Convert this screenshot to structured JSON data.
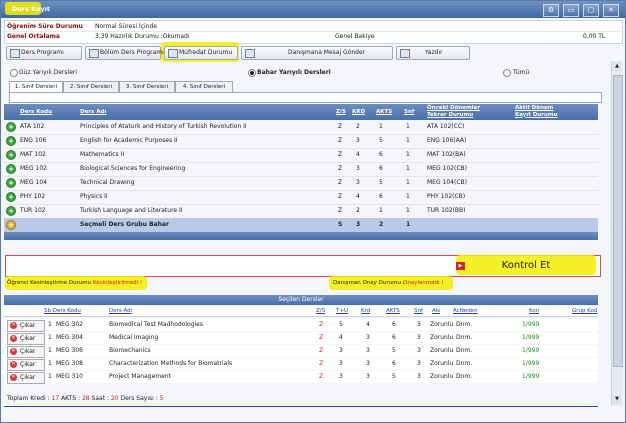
{
  "window": {
    "title": "Ders Kayıt",
    "buttons": [
      "⚙",
      "▭",
      "▢",
      "✕"
    ]
  },
  "info": {
    "status_label": "Öğrenim Süre Durumu",
    "status_value": "Normal Süresi İçinde",
    "gpa_label": "Genel Ortalama",
    "gpa_value": "3,39 Hazırlık Durumu :Okumadı",
    "balance_label": "Genel Bakiye",
    "balance_value": "0,00 TL"
  },
  "toolbar": {
    "ders_programi": "Ders Programı",
    "bolum_ders_programi": "Bölüm Ders Programı",
    "mufredat_durumu": "Müfredat Durumu",
    "danisman_mesaj": "Danışmana Mesaj Gönder",
    "yazdir": "Yazdır"
  },
  "semester_options": {
    "guz": "Güz Yarıyılı Dersleri",
    "bahar": "Bahar Yarıyılı Dersleri",
    "tumu": "Tümü",
    "selected": "bahar"
  },
  "tabs": [
    "1. Sınıf Dersleri",
    "2. Sınıf Dersleri",
    "3. Sınıf Dersleri",
    "4. Sınıf Dersleri"
  ],
  "course_table": {
    "headers": {
      "kod": "Ders Kodu",
      "ad": "Ders Adı",
      "zs": "Z/S",
      "krd": "KRD",
      "akts": "AKTS",
      "snf": "Snf",
      "onceki": "Önceki Dönemler\nTekrar Durumu",
      "aktif": "Aktif Dönem\nKayıt Durumu"
    },
    "rows": [
      {
        "kod": "ATA 102",
        "ad": "Principles of Ataturk and History of Turkish Revolution II",
        "zs": "Z",
        "krd": "2",
        "akts": "1",
        "snf": "1",
        "tekrar": "ATA 102(CC)"
      },
      {
        "kod": "ENG 106",
        "ad": "English for Academic Purposes II",
        "zs": "Z",
        "krd": "3",
        "akts": "5",
        "snf": "1",
        "tekrar": "ENG 106(AA)"
      },
      {
        "kod": "MAT 102",
        "ad": "Mathematics II",
        "zs": "Z",
        "krd": "4",
        "akts": "6",
        "snf": "1",
        "tekrar": "MAT 102(BA)"
      },
      {
        "kod": "MEG 102",
        "ad": "Biological Sciences for Engineering",
        "zs": "Z",
        "krd": "3",
        "akts": "6",
        "snf": "1",
        "tekrar": "MEG 102(CB)"
      },
      {
        "kod": "MEG 104",
        "ad": "Technical Drawing",
        "zs": "Z",
        "krd": "3",
        "akts": "5",
        "snf": "1",
        "tekrar": "MEG 104(CB)"
      },
      {
        "kod": "PHY 102",
        "ad": "Physics II",
        "zs": "Z",
        "krd": "4",
        "akts": "6",
        "snf": "1",
        "tekrar": "PHY 102(CB)"
      },
      {
        "kod": "TUR 102",
        "ad": "Turkish Language and Literature II",
        "zs": "Z",
        "krd": "2",
        "akts": "1",
        "snf": "1",
        "tekrar": "TUR 102(BB)"
      }
    ],
    "elective": {
      "kod": "",
      "ad": "Seçmeli Ders Grubu Bahar",
      "zs": "S",
      "krd": "3",
      "akts": "2",
      "snf": "1"
    }
  },
  "kontrol": {
    "label": "Kontrol Et"
  },
  "status": {
    "kesin_label": "Öğrenci Kesinleştirme Durumu :",
    "kesin_value": "Kesinleştirilmedi !",
    "danisman_label": "Danışman Onay Durumu :",
    "danisman_value": "Onaylanmadı !"
  },
  "selected": {
    "title": "Seçilen Dersler",
    "headers": {
      "sb_kod": "Sb.Ders Kodu",
      "ad": "Ders Adı",
      "zs": "Z/S",
      "tu": "T+U",
      "krd": "Krd",
      "akts": "AKTS",
      "snf": "Snf",
      "als": "Als",
      "acneden": "AcNeden",
      "kon": "Kon",
      "grup": "Grup Kod"
    },
    "remove_label": "Çıkar",
    "rows": [
      {
        "sb": "1",
        "kod": "MEG 302",
        "ad": "Biomedical Test Madhodologies",
        "zs": "Z",
        "tu": "5",
        "krd": "4",
        "akts": "6",
        "snf": "3",
        "als": "Zorunlu",
        "acneden": "Dnm.",
        "kon": "1/999"
      },
      {
        "sb": "1",
        "kod": "MEG 304",
        "ad": "Medical Imaging",
        "zs": "Z",
        "tu": "4",
        "krd": "3",
        "akts": "6",
        "snf": "3",
        "als": "Zorunlu",
        "acneden": "Dnm.",
        "kon": "1/999"
      },
      {
        "sb": "1",
        "kod": "MEG 306",
        "ad": "Biomechanics",
        "zs": "Z",
        "tu": "3",
        "krd": "3",
        "akts": "5",
        "snf": "3",
        "als": "Zorunlu",
        "acneden": "Dnm.",
        "kon": "1/999"
      },
      {
        "sb": "1",
        "kod": "MEG 308",
        "ad": "Characterization Methods for Biomatrials",
        "zs": "Z",
        "tu": "3",
        "krd": "3",
        "akts": "6",
        "snf": "3",
        "als": "Zorunlu",
        "acneden": "Dnm.",
        "kon": "1/999"
      },
      {
        "sb": "1",
        "kod": "MEG 310",
        "ad": "Project Management",
        "zs": "Z",
        "tu": "3",
        "krd": "3",
        "akts": "5",
        "snf": "3",
        "als": "Zorunlu",
        "acneden": "Dnm.",
        "kon": "1/999"
      }
    ]
  },
  "footer": {
    "kredi_label": "Toplam Kredi :",
    "kredi": "17",
    "akts_label": "AKTS :",
    "akts": "28",
    "saat_label": "Saat :",
    "saat": "20",
    "ders_label": "Ders Sayısı :",
    "ders": "5"
  }
}
